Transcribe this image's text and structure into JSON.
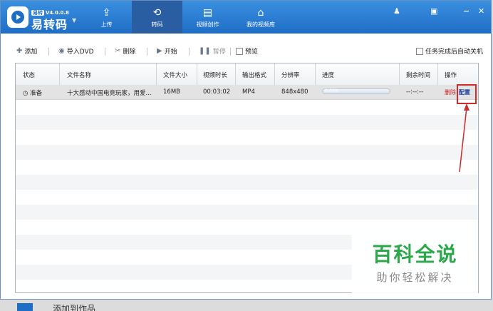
{
  "app": {
    "brand_tag": "易转",
    "version": "V4.0.0.8",
    "name": "易转码"
  },
  "nav": [
    {
      "label": "上传",
      "icon": "upload-icon"
    },
    {
      "label": "转码",
      "icon": "convert-icon",
      "active": true
    },
    {
      "label": "视频创作",
      "icon": "film-icon"
    },
    {
      "label": "我的视频库",
      "icon": "home-icon"
    }
  ],
  "toolbar": {
    "add": "添加",
    "import_dvd": "导入DVD",
    "delete": "删除",
    "start": "开始",
    "pause": "暂停",
    "preview": "预览",
    "auto_shutdown": "任务完成后自动关机"
  },
  "table": {
    "headers": [
      "状态",
      "文件名称",
      "文件大小",
      "视频时长",
      "输出格式",
      "分辨率",
      "进度",
      "剩余时间",
      "操作"
    ],
    "rows": [
      {
        "status": "准备",
        "filename": "十大感动中国电竞玩家，用爱...",
        "size": "16MB",
        "duration": "00:03:02",
        "format": "MP4",
        "resolution": "848x480",
        "progress_text": "0.00%",
        "progress": 0.0,
        "remaining": "--:--:--",
        "op_delete": "删除",
        "op_config": "配置"
      }
    ]
  },
  "watermark": {
    "title": "百科全说",
    "subtitle": "助你轻松解决"
  },
  "bottom": {
    "partial_text": "添加到作品"
  },
  "colors": {
    "titlebar": "#2b7fd6",
    "active_tab": "#2a5ea3",
    "highlight": "#d02a2a",
    "watermark": "#2aa84a"
  }
}
